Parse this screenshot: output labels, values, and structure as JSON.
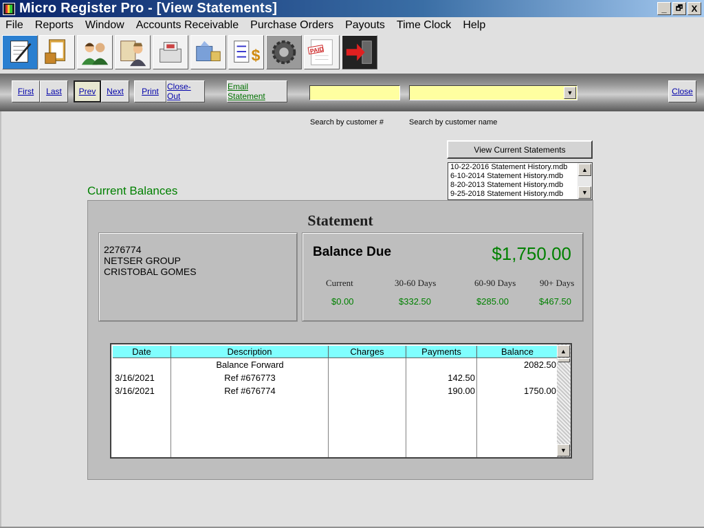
{
  "window": {
    "title": "Micro Register Pro - [View Statements]",
    "controls": {
      "minimize": "_",
      "restore": "🗗",
      "close": "X"
    }
  },
  "menu": [
    "File",
    "Reports",
    "Window",
    "Accounts Receivable",
    "Purchase Orders",
    "Payouts",
    "Time Clock",
    "Help"
  ],
  "toolbar_icons": [
    "notepad-icon",
    "clipboard-box-icon",
    "customers-icon",
    "employee-clipboard-icon",
    "register-icon",
    "shipping-icon",
    "price-list-icon",
    "settings-gear-icon",
    "paid-invoice-icon",
    "exit-icon"
  ],
  "nav": {
    "first": "First",
    "last": "Last",
    "prev": "Prev",
    "next": "Next",
    "print": "Print",
    "close_out": "Close-Out",
    "email_statement": "Email Statement",
    "close": "Close",
    "customer_number_value": "",
    "customer_name_value": ""
  },
  "hints": {
    "by_number": "Search by customer #",
    "by_name": "Search by customer name"
  },
  "view_current_statements": "View Current Statements",
  "history_files": [
    "10-22-2016 Statement History.mdb",
    "6-10-2014 Statement History.mdb",
    "8-20-2013 Statement History.mdb",
    "9-25-2018 Statement History.mdb"
  ],
  "section_title": "Current Balances",
  "statement": {
    "heading": "Statement",
    "customer": {
      "number": "2276774",
      "company": "NETSER GROUP",
      "contact": "CRISTOBAL GOMES"
    },
    "balance_label": "Balance Due",
    "balance_amount": "$1,750.00",
    "aging": [
      {
        "label": "Current",
        "value": "$0.00"
      },
      {
        "label": "30-60 Days",
        "value": "$332.50"
      },
      {
        "label": "60-90 Days",
        "value": "$285.00"
      },
      {
        "label": "90+ Days",
        "value": "$467.50"
      }
    ],
    "table": {
      "columns": [
        "Date",
        "Description",
        "Charges",
        "Payments",
        "Balance"
      ],
      "rows": [
        {
          "date": "",
          "description": "Balance Forward",
          "charges": "",
          "payments": "",
          "balance": "2082.50"
        },
        {
          "date": "3/16/2021",
          "description": "Ref #676773",
          "charges": "",
          "payments": "142.50",
          "balance": ""
        },
        {
          "date": "3/16/2021",
          "description": "Ref #676774",
          "charges": "",
          "payments": "190.00",
          "balance": "1750.00"
        }
      ]
    }
  },
  "colors": {
    "accent_green": "#008000",
    "header_cyan": "#80ffff",
    "search_yellow": "#ffffa0",
    "title_blue": "#0a246a"
  }
}
